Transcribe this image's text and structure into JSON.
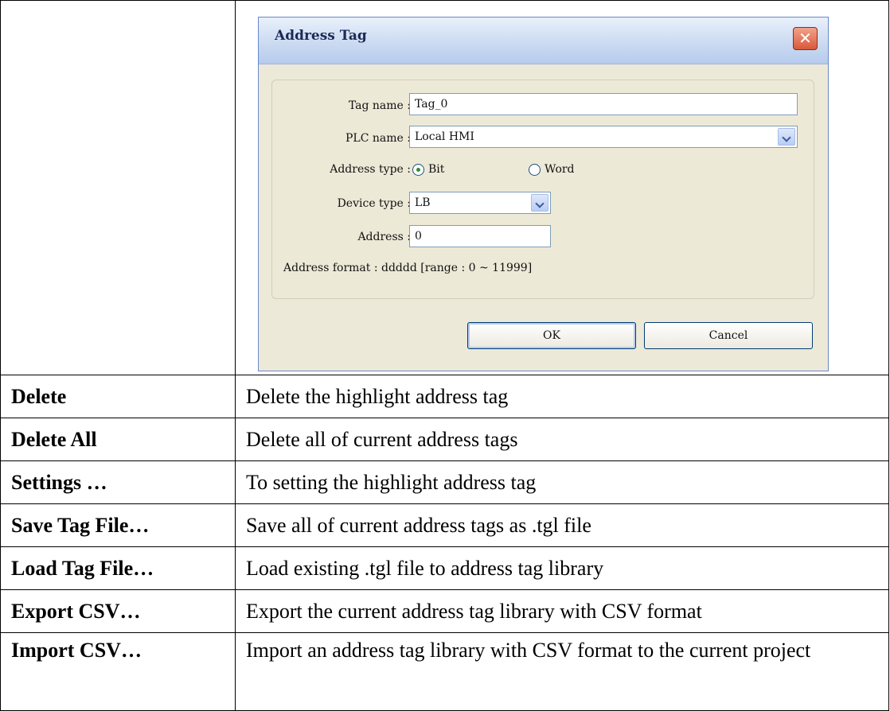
{
  "dialog": {
    "title": "Address Tag",
    "close_glyph": "✕",
    "tag_name_label": "Tag name :",
    "tag_name_value": "Tag_0",
    "plc_name_label": "PLC name :",
    "plc_name_value": "Local HMI",
    "address_type_label": "Address type :",
    "address_type_options": [
      "Bit",
      "Word"
    ],
    "address_type_selected": "Bit",
    "device_type_label": "Device type :",
    "device_type_value": "LB",
    "address_label": "Address :",
    "address_value": "0",
    "address_format_text": "Address format : ddddd [range : 0 ~ 11999]",
    "ok_label": "OK",
    "cancel_label": "Cancel"
  },
  "table": {
    "rows": [
      {
        "key": "Delete",
        "desc": "Delete the highlight address tag"
      },
      {
        "key": "Delete All",
        "desc": "Delete all of current address tags"
      },
      {
        "key": "Settings …",
        "desc": "To setting the highlight address tag"
      },
      {
        "key": "Save Tag File…",
        "desc": "Save all of current address tags as .tgl file"
      },
      {
        "key": "Load Tag File…",
        "desc": "Load existing .tgl file to address tag library"
      },
      {
        "key": "Export CSV…",
        "desc": "Export the current address tag library with CSV format"
      },
      {
        "key": "Import CSV…",
        "desc": "Import an address tag library with CSV format to the current project"
      }
    ]
  },
  "icons": {
    "close": "close-icon",
    "dropdown": "chevron-down-icon"
  },
  "colors": {
    "titlebar": "#c9d9f1",
    "dialog_bg": "#ece9d8",
    "close_button": "#d9583a"
  }
}
